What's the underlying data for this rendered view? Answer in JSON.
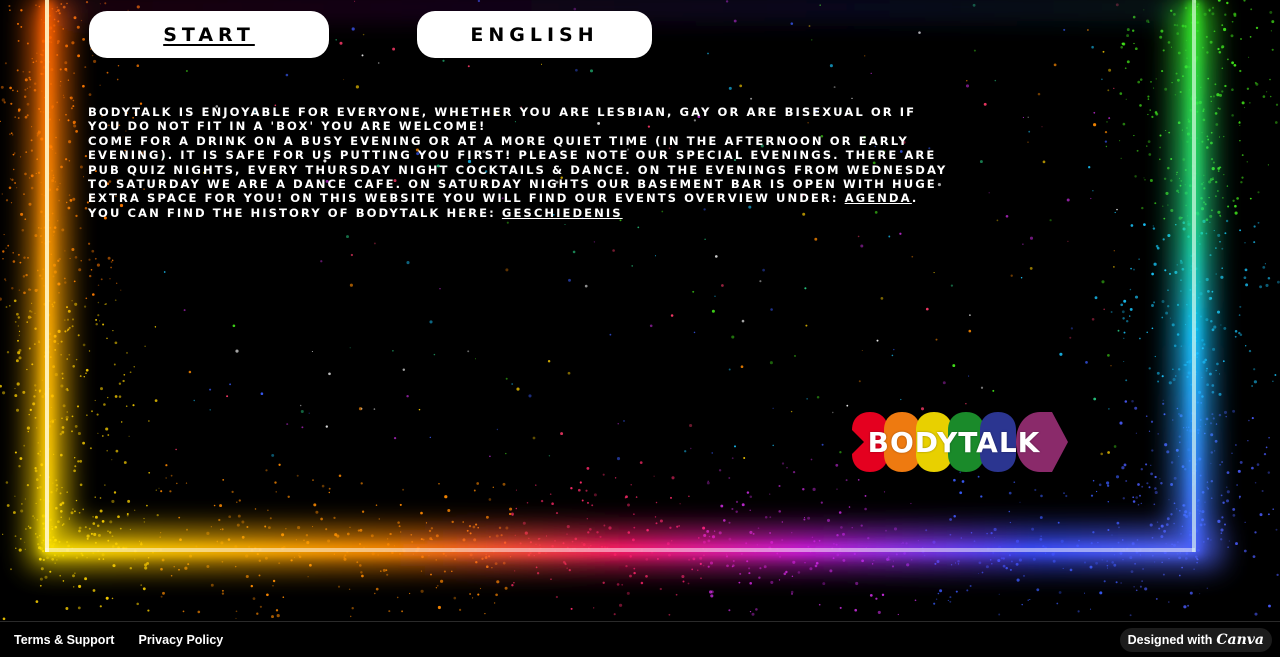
{
  "nav": {
    "start_label": "START",
    "language_label": "ENGLISH"
  },
  "intro": {
    "line1": "Bodytalk is enjoyable for everyone, whether you are lesbian, gay or are bisexual or if",
    "line2": "you do not fit in a 'box' you are welcome!",
    "line3": "Come for a drink on a busy evening or at a more quiet time (in the afternoon or early",
    "line4": "evening). It is safe for us putting you first! Please note our special evenings. There are",
    "line5": "pub quiz nights, every Thursday night cocktails & dance. On the evenings from Wednesday",
    "line6": "to Saturday we are a dance cafe. On Saturday nights our basement bar is open with huge",
    "line7_before": "extra space for you! On this website you will find our events overview under: ",
    "agenda_link": "AGENDA",
    "line7_after": ".",
    "line8_before": "You can find the history of Bodytalk here: ",
    "history_link": "GESCHIEDENIS"
  },
  "logo": {
    "text": "BODYTALK",
    "heart_colors": [
      "#e4001f",
      "#ee7a10",
      "#e8d000",
      "#1a8a2a",
      "#2b3590",
      "#8a2a6a"
    ]
  },
  "footer": {
    "terms_label": "Terms & Support",
    "privacy_label": "Privacy Policy",
    "designed_with_label": "Designed with",
    "canva_label": "Canva"
  }
}
